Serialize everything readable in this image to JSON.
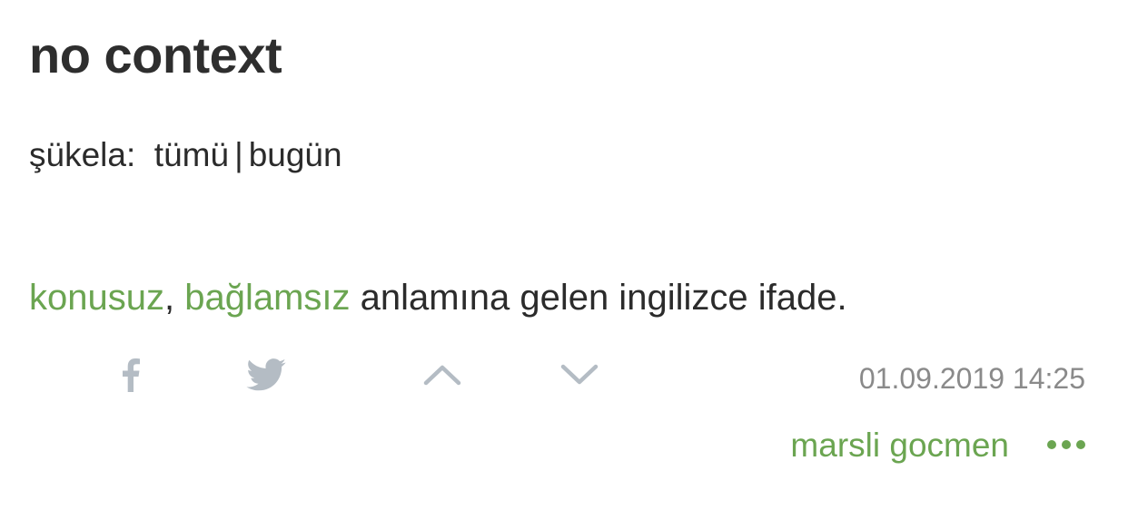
{
  "entry_title": "no context",
  "sukela": {
    "label": "şükela:",
    "all": "tümü",
    "separator": "|",
    "today": "bugün"
  },
  "entry": {
    "link1": "konusuz",
    "comma": ",",
    "link2": "bağlamsız",
    "text": " anlamına gelen ingilizce ifade."
  },
  "actions": {
    "facebook_icon": "facebook-icon",
    "twitter_icon": "twitter-icon",
    "upvote_icon": "chevron-up-icon",
    "downvote_icon": "chevron-down-icon"
  },
  "date": "01.09.2019 14:25",
  "author": "marsli gocmen",
  "more_icon": "more-dots-icon",
  "colors": {
    "link_green": "#6ba551",
    "icon_gray": "#b4bcc4",
    "text_dark": "#2b2b2b",
    "date_gray": "#8a8a8a"
  }
}
